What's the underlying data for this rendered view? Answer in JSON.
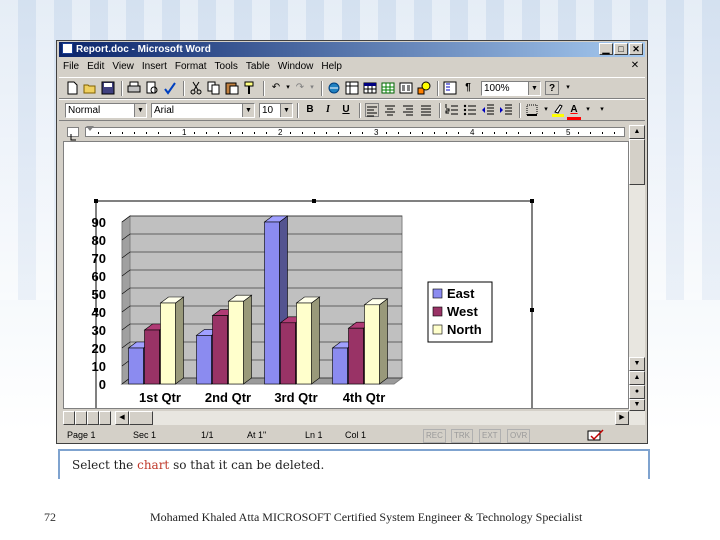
{
  "window": {
    "title": "Report.doc - Microsoft Word",
    "minimize_glyph": "▁",
    "maximize_glyph": "□",
    "close_glyph": "✕"
  },
  "menubar": {
    "items": [
      "File",
      "Edit",
      "View",
      "Insert",
      "Format",
      "Tools",
      "Table",
      "Window",
      "Help"
    ],
    "doc_close_glyph": "✕"
  },
  "standard_toolbar": {
    "undo_glyph": "↶",
    "redo_glyph": "↷",
    "zoom_value": "100%",
    "help_glyph": "?"
  },
  "formatting_toolbar": {
    "style_value": "Normal",
    "font_value": "Arial",
    "size_value": "10",
    "bold_label": "B",
    "italic_label": "I",
    "underline_label": "U",
    "font_color_label": "A",
    "highlight_color": "#ffff00",
    "font_color": "#ff0000"
  },
  "ruler": {
    "labels": [
      "1",
      "2",
      "3",
      "4",
      "5"
    ]
  },
  "statusbar": {
    "page": "Page 1",
    "section": "Sec 1",
    "page_of": "1/1",
    "at": "At 1\"",
    "line": "Ln 1",
    "col": "Col 1",
    "rec": "REC",
    "trk": "TRK",
    "ext": "EXT",
    "ovr": "OVR"
  },
  "chart_data": {
    "type": "bar",
    "categories": [
      "1st Qtr",
      "2nd Qtr",
      "3rd Qtr",
      "4th Qtr"
    ],
    "series": [
      {
        "name": "East",
        "values": [
          20,
          27,
          90,
          20
        ],
        "color": "#8b8bf0"
      },
      {
        "name": "West",
        "values": [
          30,
          38,
          34,
          31
        ],
        "color": "#993366"
      },
      {
        "name": "North",
        "values": [
          45,
          46,
          45,
          44
        ],
        "color": "#ffffcc"
      }
    ],
    "ylim": [
      0,
      90
    ],
    "yticks": [
      0,
      10,
      20,
      30,
      40,
      50,
      60,
      70,
      80,
      90
    ],
    "ytick_labels": [
      "0",
      "10",
      "20",
      "30",
      "40",
      "50",
      "60",
      "70",
      "80",
      "90"
    ],
    "grid": true,
    "legend": "right",
    "plot_color": "#c0c0c0",
    "title": "",
    "xlabel": "",
    "ylabel": ""
  },
  "caption": {
    "before": "Select the ",
    "highlight": "chart",
    "after": " so that it can be deleted."
  },
  "footer": {
    "page_number": "72",
    "credit": "Mohamed Khaled Atta MICROSOFT Certified System Engineer & Technology Specialist"
  }
}
